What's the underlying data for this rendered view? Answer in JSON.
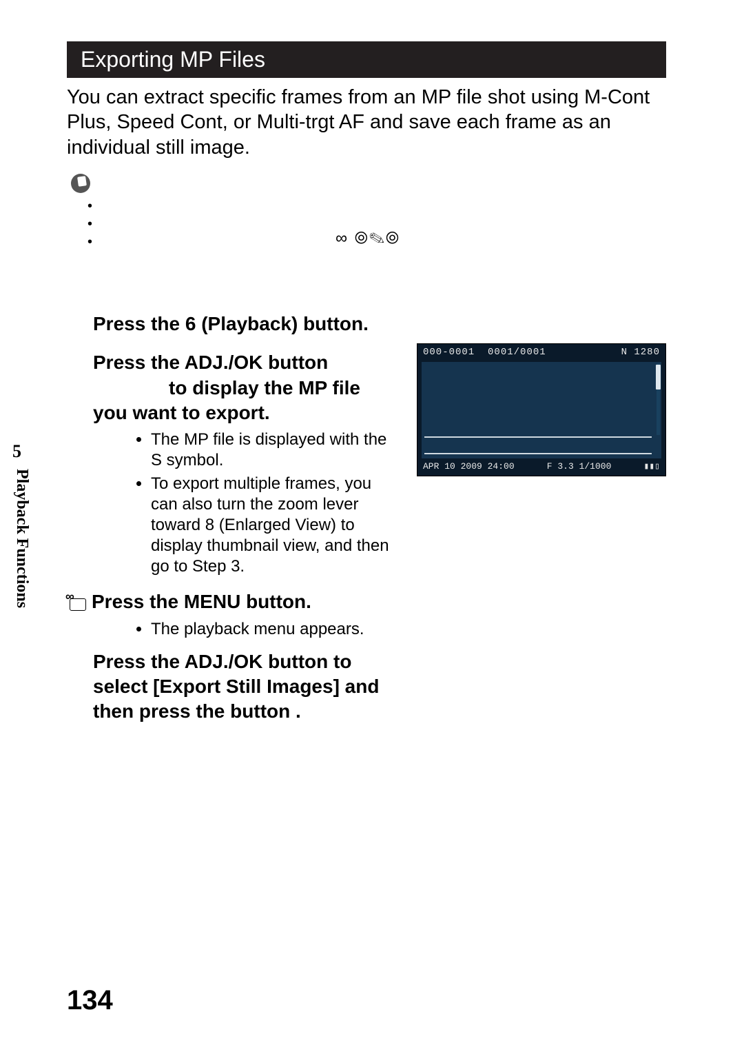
{
  "heading": "Exporting MP Files",
  "intro": "You can extract specific frames from an MP file shot using M-Cont Plus, Speed Cont, or Multi-trgt AF and save each frame as an individual still image.",
  "note_bullets": [
    "",
    "",
    ""
  ],
  "symbol_row": "∞ ⦾✎⦾",
  "step1": {
    "pre": "Press the ",
    "glyph": "6",
    "post": "   (Playback) button."
  },
  "step2": {
    "line1": "Press the ADJ./OK button",
    "line2": "to display the MP file",
    "line3": "you want to export.",
    "bullets": [
      "The MP file is displayed with the S symbol.",
      "To export multiple frames, you can also turn the zoom lever toward 8 (Enlarged View) to display thumbnail view, and then go to Step 3."
    ]
  },
  "step3": {
    "title": "Press the MENU button.",
    "bullets": [
      "The playback menu appears."
    ]
  },
  "step4": {
    "line1": "Press the ADJ./OK button      to",
    "line2": "select [Export Still Images] and",
    "line3": "then press the button      ."
  },
  "display": {
    "folder": "000-0001",
    "frame": "0001/0001",
    "mode": "N 1280",
    "date": "APR 10 2009 24:00",
    "exposure": "F 3.3 1/1000",
    "battery_icon": "▮▮▯"
  },
  "side": {
    "chapter_number": "5",
    "chapter_title": "Playback Functions"
  },
  "page_number": "134"
}
